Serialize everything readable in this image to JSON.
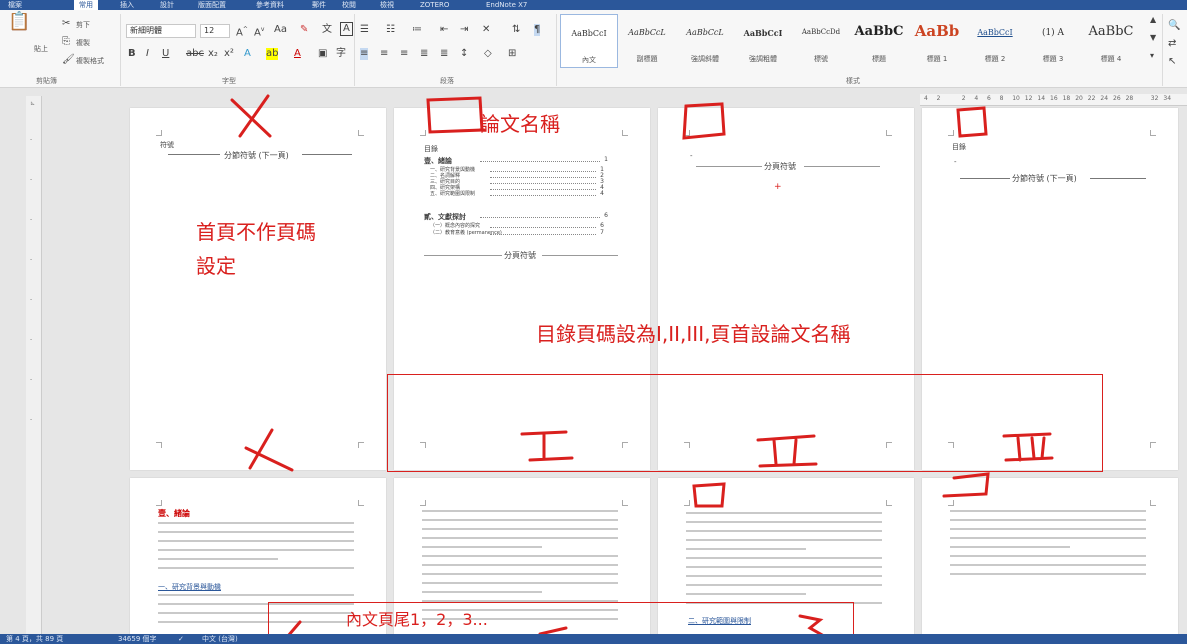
{
  "tabs": [
    "檔案",
    "常用",
    "插入",
    "設計",
    "版面配置",
    "參考資料",
    "郵件",
    "校閱",
    "檢視",
    "ZOTERO",
    "EndNote X7"
  ],
  "clipboard": {
    "cut": "剪下",
    "copy": "複製",
    "paste": "貼上",
    "format_painter": "複製格式",
    "label": "剪貼簿"
  },
  "font": {
    "name": "新細明體",
    "size": "12",
    "label": "字型"
  },
  "paragraph": {
    "label": "段落"
  },
  "styles": {
    "label": "樣式",
    "items": [
      {
        "sample": "AaBbCcI",
        "name": "內文"
      },
      {
        "sample": "AaBbCcL",
        "name": "副標題"
      },
      {
        "sample": "AaBbCcL",
        "name": "強調斜體"
      },
      {
        "sample": "AaBbCcI",
        "name": "強調粗體"
      },
      {
        "sample": "AaBbCcDd",
        "name": "標號"
      },
      {
        "sample": "AaBbC",
        "name": "標題"
      },
      {
        "sample": "AaBb",
        "name": "標題 1"
      },
      {
        "sample": "AaBbCcI",
        "name": "標題 2"
      },
      {
        "sample": "(1) A",
        "name": "標題 3"
      },
      {
        "sample": "AaBbC",
        "name": "標題 4"
      }
    ]
  },
  "ruler_numbers": [
    "4",
    "2",
    "",
    "2",
    "4",
    "6",
    "8",
    "10",
    "12",
    "14",
    "16",
    "18",
    "20",
    "22",
    "24",
    "26",
    "28",
    "",
    "32",
    "34"
  ],
  "pages": {
    "p1": {
      "section_break": "分節符號 (下一頁)",
      "symbol": "符號"
    },
    "p2": {
      "symbol": "目錄",
      "toc": [
        {
          "text": "壹、緒論",
          "page": "1",
          "bold": true
        },
        {
          "text": "一、研究背景與動機",
          "page": "1"
        },
        {
          "text": "二、名詞解釋",
          "page": "2"
        },
        {
          "text": "三、研究目的",
          "page": "3"
        },
        {
          "text": "四、研究架構",
          "page": "4"
        },
        {
          "text": "五、研究範圍與限制",
          "page": "4"
        },
        {
          "text": "貳、文獻探討",
          "page": "6",
          "bold": true
        },
        {
          "text": "（一）概念內容的探究",
          "page": "6"
        },
        {
          "text": "（二）教育意義 (permanence)",
          "page": "7"
        }
      ],
      "page_break": "分頁符號"
    },
    "p3": {
      "page_break": "分頁符號"
    },
    "p4": {
      "symbol": "目錄",
      "section_break": "分節符號 (下一頁)"
    },
    "p5": {
      "heading": "壹、緒論",
      "sub": "一、研究背景與動機"
    },
    "p7": {
      "sub": "二、研究範圍與限制"
    }
  },
  "annotations": {
    "thesis_name": "論文名稱",
    "first_page": "首頁不作頁碼",
    "first_page2": "設定",
    "toc_page": "目錄頁碼設為I,II,III,頁首設論文名稱",
    "body_footer": "內文頁尾1，2，3...",
    "roman1": "I",
    "roman2": "II",
    "roman3": "III",
    "num3": "3"
  },
  "status": {
    "page": "第 4 頁，共 89 頁",
    "words": "34659 個字",
    "lang": "中文 (台灣)"
  }
}
